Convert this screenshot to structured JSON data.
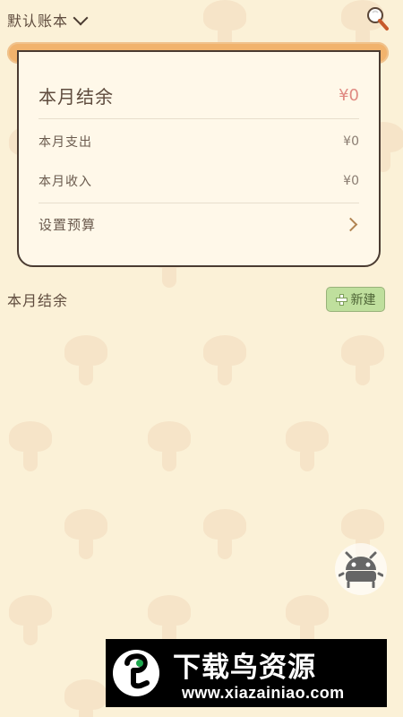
{
  "header": {
    "ledger_name": "默认账本",
    "search_icon": "search-icon",
    "dropdown_icon": "chevron-down-icon"
  },
  "summary": {
    "balance_label": "本月结余",
    "balance_value": "¥0",
    "expense_label": "本月支出",
    "expense_value": "¥0",
    "income_label": "本月收入",
    "income_value": "¥0",
    "budget_label": "设置预算",
    "budget_icon": "chevron-right-icon"
  },
  "section": {
    "title": "本月结余",
    "new_button": "新建",
    "new_icon": "plus-icon"
  },
  "floating": {
    "icon": "android-robot-icon"
  },
  "watermark": {
    "title": "下载鸟资源",
    "url": "www.xiazainiao.com",
    "logo_icon": "bird-logo-icon"
  },
  "colors": {
    "background": "#fbf1d7",
    "accent": "#f1b36d",
    "balance_value": "#e08a82",
    "new_button": "#bfdf9d"
  }
}
